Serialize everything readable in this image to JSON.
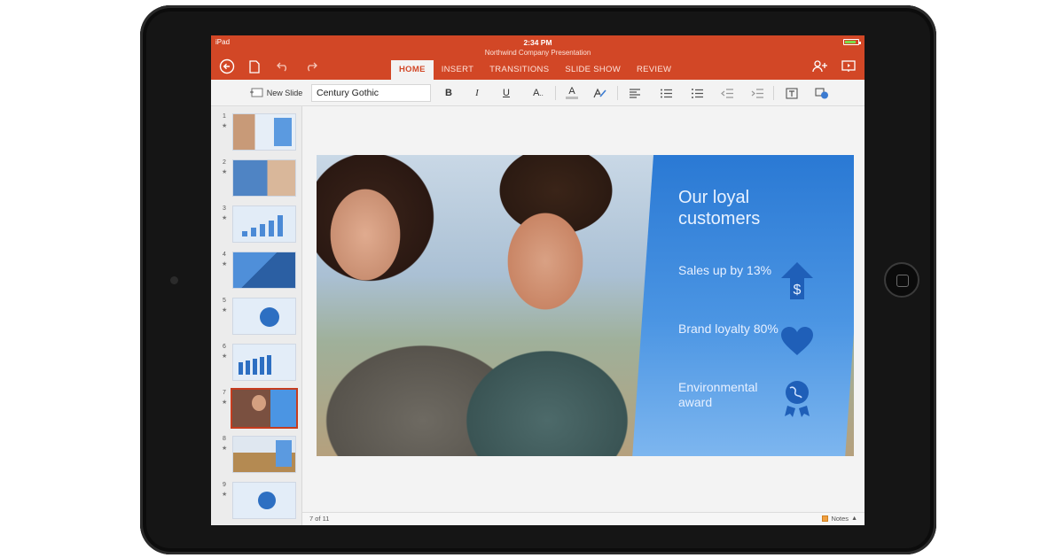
{
  "status": {
    "device": "iPad",
    "time": "2:34 PM"
  },
  "document": {
    "title": "Northwind Company Presentation"
  },
  "tabs": [
    {
      "label": "HOME",
      "active": true
    },
    {
      "label": "INSERT",
      "active": false
    },
    {
      "label": "TRANSITIONS",
      "active": false
    },
    {
      "label": "SLIDE SHOW",
      "active": false
    },
    {
      "label": "REVIEW",
      "active": false
    }
  ],
  "ribbon": {
    "new_slide_label": "New Slide",
    "font_name": "Century Gothic",
    "bold": "B",
    "italic": "I",
    "underline": "U",
    "font_size": "A",
    "font_color": "A"
  },
  "slides": [
    {
      "number": "1",
      "star": "★"
    },
    {
      "number": "2",
      "star": "★"
    },
    {
      "number": "3",
      "star": "★"
    },
    {
      "number": "4",
      "star": "★"
    },
    {
      "number": "5",
      "star": "★"
    },
    {
      "number": "6",
      "star": "★"
    },
    {
      "number": "7",
      "star": "★"
    },
    {
      "number": "8",
      "star": "★"
    },
    {
      "number": "9",
      "star": "★"
    }
  ],
  "current_slide": {
    "title": "Our loyal customers",
    "stats": [
      {
        "text": "Sales up by 13%",
        "icon": "dollar-up-arrow-icon"
      },
      {
        "text": "Brand loyalty 80%",
        "icon": "heart-icon"
      },
      {
        "text": "Environmental award",
        "icon": "globe-award-icon"
      }
    ]
  },
  "footer": {
    "position": "7 of 11",
    "notes_label": "Notes"
  },
  "colors": {
    "accent": "#d24726",
    "slide_blue": "#2a79d4"
  }
}
